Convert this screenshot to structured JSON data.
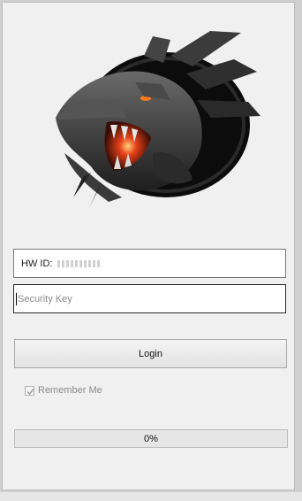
{
  "logo": {
    "icon": "dragon-head-logo"
  },
  "hwid": {
    "label": "HW ID:",
    "value_redacted": true
  },
  "security_key": {
    "placeholder": "Security Key",
    "value": ""
  },
  "login_button": {
    "label": "Login"
  },
  "remember_me": {
    "label": "Remember Me",
    "checked": true,
    "enabled": false
  },
  "progress": {
    "value": 0,
    "text": "0%"
  },
  "colors": {
    "window_bg": "#f0f0f0",
    "dragon_glow": "#e8421a",
    "field_border": "#7a7a7a"
  }
}
